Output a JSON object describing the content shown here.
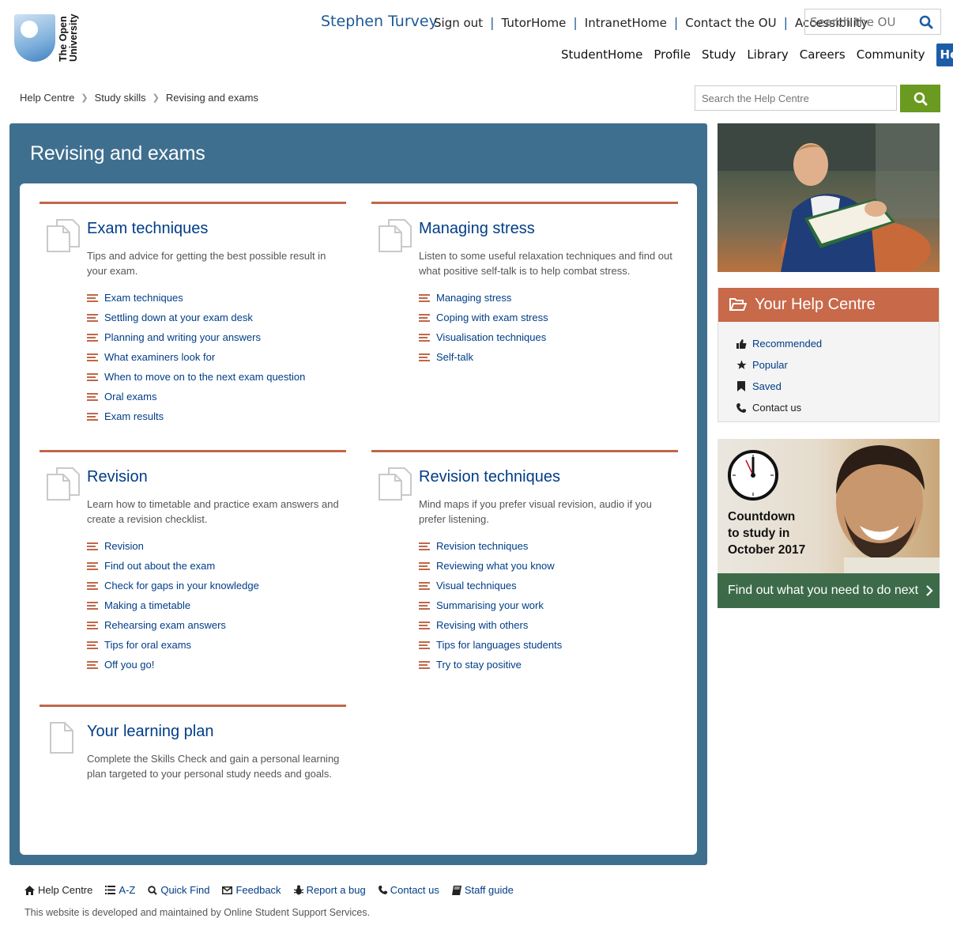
{
  "header": {
    "logo_text": "The Open University",
    "user_name": "Stephen Turvey",
    "top_links": [
      "Sign out",
      "TutorHome",
      "IntranetHome",
      "Contact the OU",
      "Accessibility"
    ],
    "search_placeholder": "Search the OU",
    "nav": [
      "StudentHome",
      "Profile",
      "Study",
      "Library",
      "Careers",
      "Community",
      "Help Centre"
    ],
    "nav_active": "Help Centre",
    "accent_color": "#1d5da8"
  },
  "breadcrumb": [
    "Help Centre",
    "Study skills",
    "Revising and exams"
  ],
  "help_search": {
    "placeholder": "Search the Help Centre"
  },
  "main": {
    "title": "Revising and exams",
    "panel_color": "#3f6f8f",
    "rule_color": "#c0674a",
    "topics": [
      {
        "title": "Exam techniques",
        "desc": "Tips and advice for getting the best possible result in your exam.",
        "links": [
          "Exam techniques",
          "Settling down at your exam desk",
          "Planning and writing your answers",
          "What examiners look for",
          "When to move on to the next exam question",
          "Oral exams",
          "Exam results"
        ]
      },
      {
        "title": "Managing stress",
        "desc": "Listen to some useful relaxation techniques and find out what positive self-talk is to help combat stress.",
        "links": [
          "Managing stress",
          "Coping with exam stress",
          "Visualisation techniques",
          "Self-talk"
        ]
      },
      {
        "title": "Revision",
        "desc": "Learn how to timetable and practice exam answers and create a revision checklist.",
        "links": [
          "Revision",
          "Find out about the exam",
          "Check for gaps in your knowledge",
          "Making a timetable",
          "Rehearsing exam answers",
          "Tips for oral exams",
          "Off you go!"
        ]
      },
      {
        "title": "Revision techniques",
        "desc": "Mind maps if you prefer visual revision, audio if you prefer listening.",
        "links": [
          "Revision techniques",
          "Reviewing what you know",
          "Visual techniques",
          "Summarising your work",
          "Revising with others",
          "Tips for languages students",
          "Try to stay positive"
        ]
      },
      {
        "title": "Your learning plan",
        "desc": "Complete the Skills Check and gain a personal learning plan targeted to your personal study needs and goals.",
        "links": []
      }
    ]
  },
  "sidebar": {
    "your_help_centre": {
      "title": "Your Help Centre",
      "items": [
        {
          "label": "Recommended",
          "icon": "thumbs-up-icon"
        },
        {
          "label": "Popular",
          "icon": "star-icon"
        },
        {
          "label": "Saved",
          "icon": "bookmark-icon"
        },
        {
          "label": "Contact us",
          "icon": "phone-icon"
        }
      ],
      "header_color": "#c8694a"
    },
    "promo": {
      "line1": "Countdown",
      "line2": "to study in",
      "line3": "October 2017",
      "cta": "Find out what you need to do next",
      "cta_color": "#3d6b4a"
    }
  },
  "footer": {
    "links": [
      {
        "label": "Help Centre",
        "icon": "home-icon"
      },
      {
        "label": "A-Z",
        "icon": "list-icon"
      },
      {
        "label": "Quick Find",
        "icon": "search-icon"
      },
      {
        "label": "Feedback",
        "icon": "envelope-icon"
      },
      {
        "label": "Report a bug",
        "icon": "bug-icon"
      },
      {
        "label": "Contact us",
        "icon": "phone-icon"
      },
      {
        "label": "Staff guide",
        "icon": "book-icon"
      }
    ],
    "note": "This website is developed and maintained by Online Student Support Services."
  }
}
